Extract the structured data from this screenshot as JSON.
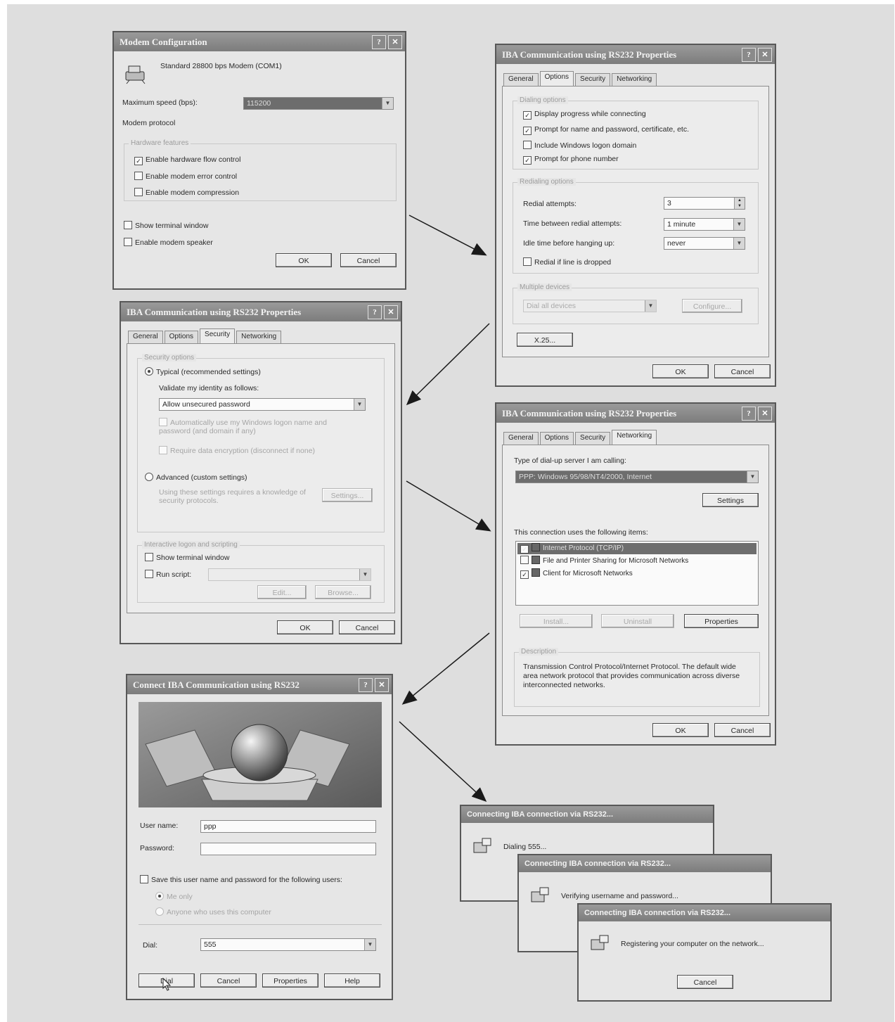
{
  "modem": {
    "title": "Modem Configuration",
    "device": "Standard 28800 bps Modem (COM1)",
    "max_speed_label": "Maximum speed (bps):",
    "max_speed_value": "115200",
    "protocol_label": "Modem protocol",
    "hw_group": "Hardware features",
    "hw_flow": "Enable hardware flow control",
    "error_control": "Enable modem error control",
    "compression": "Enable modem compression",
    "show_terminal": "Show terminal window",
    "speaker": "Enable modem speaker",
    "ok": "OK",
    "cancel": "Cancel"
  },
  "options": {
    "title": "IBA Communication using RS232 Properties",
    "tabs": [
      "General",
      "Options",
      "Security",
      "Networking"
    ],
    "dialing_group": "Dialing options",
    "opt1": "Display progress while connecting",
    "opt2": "Prompt for name and password, certificate, etc.",
    "opt3": "Include Windows logon domain",
    "opt4": "Prompt for phone number",
    "redial_group": "Redialing options",
    "redial_attempts_label": "Redial attempts:",
    "redial_attempts_value": "3",
    "time_between_label": "Time between redial attempts:",
    "time_between_value": "1 minute",
    "idle_label": "Idle time before hanging up:",
    "idle_value": "never",
    "redial_dropped": "Redial if line is dropped",
    "multi_group": "Multiple devices",
    "multi_value": "Dial all devices",
    "configure": "Configure...",
    "x25": "X.25...",
    "ok": "OK",
    "cancel": "Cancel"
  },
  "security": {
    "title": "IBA Communication using RS232 Properties",
    "tabs": [
      "General",
      "Options",
      "Security",
      "Networking"
    ],
    "sec_group": "Security options",
    "typical": "Typical (recommended settings)",
    "validate_label": "Validate my identity as follows:",
    "validate_value": "Allow unsecured password",
    "auto_use": "Automatically use my Windows logon name and password (and domain if any)",
    "require_enc": "Require data encryption (disconnect if none)",
    "advanced": "Advanced (custom settings)",
    "adv_desc": "Using these settings requires a knowledge of security protocols.",
    "settings": "Settings...",
    "script_group": "Interactive logon and scripting",
    "show_terminal": "Show terminal window",
    "run_script": "Run script:",
    "edit": "Edit...",
    "browse": "Browse...",
    "ok": "OK",
    "cancel": "Cancel"
  },
  "networking": {
    "title": "IBA Communication using RS232 Properties",
    "tabs": [
      "General",
      "Options",
      "Security",
      "Networking"
    ],
    "server_label": "Type of dial-up server I am calling:",
    "server_value": "PPP: Windows 95/98/NT4/2000, Internet",
    "settings": "Settings",
    "items_label": "This connection uses the following items:",
    "items": [
      "Internet Protocol (TCP/IP)",
      "File and Printer Sharing for Microsoft Networks",
      "Client for Microsoft Networks"
    ],
    "install": "Install...",
    "uninstall": "Uninstall",
    "properties": "Properties",
    "desc_group": "Description",
    "description": "Transmission Control Protocol/Internet Protocol. The default wide area network protocol that provides communication across diverse interconnected networks.",
    "ok": "OK",
    "cancel": "Cancel"
  },
  "connect": {
    "title": "Connect IBA Communication using RS232",
    "user_label": "User name:",
    "user_value": "ppp",
    "password_label": "Password:",
    "save_label": "Save this user name and password for the following users:",
    "me_only": "Me only",
    "anyone": "Anyone who uses this computer",
    "dial_label": "Dial:",
    "dial_value": "555",
    "dial_btn": "Dial",
    "cancel": "Cancel",
    "properties": "Properties",
    "help": "Help"
  },
  "progress": [
    {
      "title": "Connecting IBA connection via RS232...",
      "message": "Dialing 555..."
    },
    {
      "title": "Connecting IBA connection via RS232...",
      "message": "Verifying username and password..."
    },
    {
      "title": "Connecting IBA connection via RS232...",
      "message": "Registering your computer on the network...",
      "cancel": "Cancel"
    }
  ]
}
